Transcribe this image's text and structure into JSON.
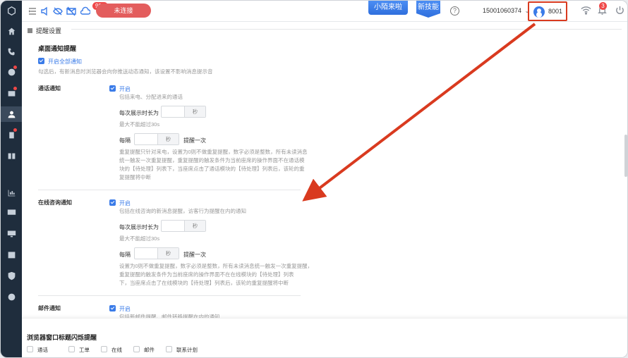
{
  "topbar": {
    "notification_badge": "99+",
    "disconnect_label": "未连接",
    "promo_1": "小陌来啦",
    "promo_2": "新技能",
    "help_label": "?",
    "account": "15001060374",
    "agent_id": "8001",
    "alarm_badge": "3"
  },
  "sidebar": {
    "items": [
      {
        "icon": "home-icon"
      },
      {
        "icon": "phone-icon"
      },
      {
        "icon": "chat-icon"
      },
      {
        "icon": "mail-icon"
      },
      {
        "icon": "user-icon",
        "active": true
      },
      {
        "icon": "clipboard-icon"
      },
      {
        "icon": "book-icon"
      },
      {
        "icon": "chart-icon"
      },
      {
        "icon": "monitor-plus-icon"
      },
      {
        "icon": "monitor-icon"
      },
      {
        "icon": "calendar-icon"
      },
      {
        "icon": "shield-icon"
      },
      {
        "icon": "plus-circle-icon"
      }
    ]
  },
  "page": {
    "section_title": "提醒设置",
    "desktop_title": "桌面通知提醒",
    "enable_all": "开启全部通知",
    "enable_all_hint": "勾选后，有新消息时浏览器会向你推送动态通知，该设置不影响消息提示音",
    "call": {
      "label": "通话通知",
      "enable": "开启",
      "hint": "包括来电、分配进来的通话",
      "duration_label": "每次展示时长为",
      "unit": "秒",
      "max_hint": "最大不能超过30s",
      "every_label": "每隔",
      "repeat_label": "提醒一次",
      "repeat_hint_1": "重复提醒只针对来电，设置为0则不做重复提醒，数字必须是整数，所有未读消息",
      "repeat_hint_2": "统一触发一次重复提醒，重复提醒的触发条件为当前座席的操作界面不在通话模",
      "repeat_hint_3": "块的【待处理】列表下，当座席点击了通话模块的【待处理】列表后，该轮的重",
      "repeat_hint_4": "复提醒将中断"
    },
    "online": {
      "label": "在线咨询通知",
      "enable": "开启",
      "hint": "包括在线咨询的新消息提醒，访客行为提醒在内的通知",
      "duration_label": "每次展示时长为",
      "unit": "秒",
      "max_hint": "最大不能超过30s",
      "every_label": "每隔",
      "repeat_label": "提醒一次",
      "repeat_hint_1": "设置为0则不做重复提醒，数字必须是整数，所有未读消息统一触发一次重复提醒，",
      "repeat_hint_2": "重复提醒的触发条件为当前座席的操作界面不在在线模块的【待处理】列表",
      "repeat_hint_3": "下，当座席点击了在线模块的【待处理】列表后，该轮的重复提醒将中断"
    },
    "mail": {
      "label": "邮件通知",
      "enable": "开启",
      "hint": "包括新邮件提醒、邮件转移提醒在内的通知"
    },
    "flash": {
      "title": "浏览器窗口标题闪烁提醒",
      "options": [
        "通话",
        "工单",
        "在线",
        "邮件",
        "联系计划"
      ]
    }
  }
}
